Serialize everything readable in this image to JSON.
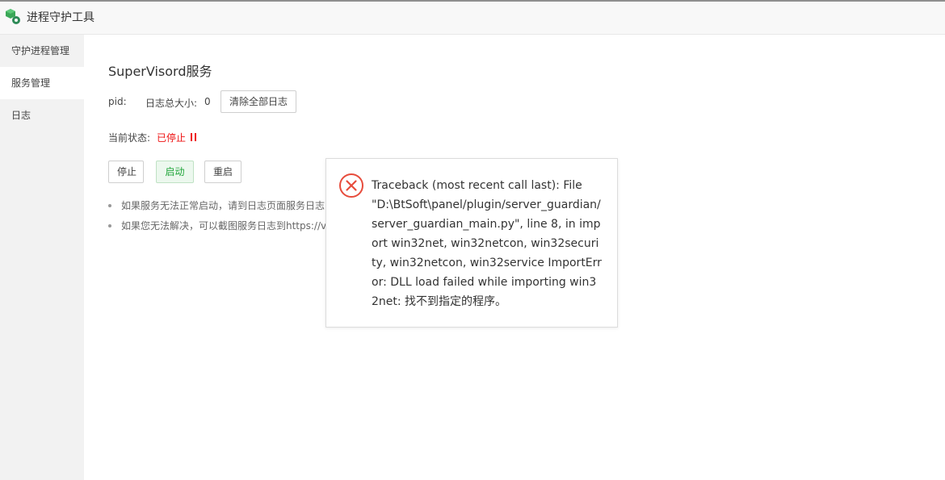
{
  "app": {
    "title": "进程守护工具"
  },
  "sidebar": {
    "items": [
      {
        "label": "守护进程管理"
      },
      {
        "label": "服务管理"
      },
      {
        "label": "日志"
      }
    ]
  },
  "service": {
    "title": "SuperVisord服务",
    "pid_label": "pid:",
    "log_size_label": "日志总大小:",
    "log_size_value": "0",
    "clear_logs_button": "清除全部日志",
    "status_label": "当前状态:",
    "status_value": "已停止",
    "status_color": "#ee1111",
    "buttons": {
      "stop": "停止",
      "start": "启动",
      "restart": "重启"
    },
    "tips": [
      "如果服务无法正常启动，请到日志页面服务日志",
      "如果您无法解决，可以截图服务日志到https://v"
    ]
  },
  "error_dialog": {
    "icon": "error-circle-icon",
    "message": "Traceback (most recent call last): File \"D:\\BtSoft\\panel/plugin/server_guardian/server_guardian_main.py\", line 8, in import win32net, win32netcon, win32security, win32netcon, win32service ImportError: DLL load failed while importing win32net: 找不到指定的程序。"
  },
  "colors": {
    "accent_green": "#20a53a",
    "error_red": "#e74c3c"
  }
}
